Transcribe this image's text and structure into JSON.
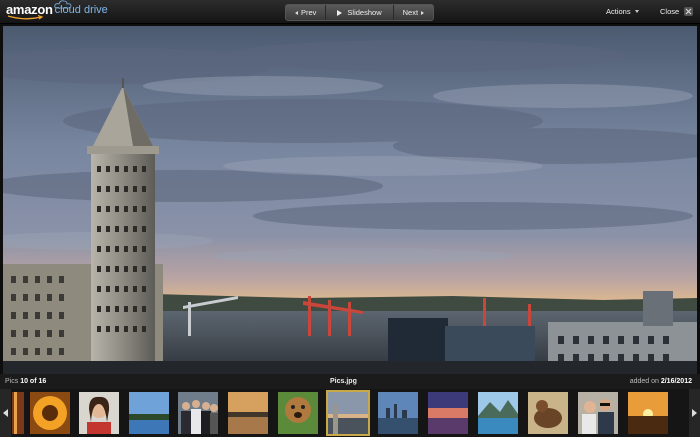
{
  "app": {
    "logo_primary": "amazon",
    "logo_secondary": "cloud drive"
  },
  "nav": {
    "prev_label": "Prev",
    "slideshow_label": "Slideshow",
    "next_label": "Next"
  },
  "toolbar": {
    "actions_label": "Actions",
    "close_label": "Close"
  },
  "photo": {
    "alt": "Pics.jpg"
  },
  "info": {
    "count_prefix": "Pics",
    "count_text": "10 of 16",
    "filename": "Pics.jpg",
    "added_prefix": "added on",
    "added_date": "2/16/2012"
  },
  "filmstrip": {
    "selected_index": 6,
    "thumbnails": [
      {
        "name": "thumb-sunflower"
      },
      {
        "name": "thumb-girl-portrait"
      },
      {
        "name": "thumb-lake"
      },
      {
        "name": "thumb-group-people"
      },
      {
        "name": "thumb-sunset-water"
      },
      {
        "name": "thumb-dog"
      },
      {
        "name": "thumb-seattle-skyline"
      },
      {
        "name": "thumb-city-skyline"
      },
      {
        "name": "thumb-purple-sunset"
      },
      {
        "name": "thumb-lake-mountains"
      },
      {
        "name": "thumb-dog-grass"
      },
      {
        "name": "thumb-couple"
      },
      {
        "name": "thumb-orange-sunset"
      }
    ]
  },
  "colors": {
    "accent_gold": "#c9a84a",
    "logo_blue": "#7fb6e8"
  }
}
